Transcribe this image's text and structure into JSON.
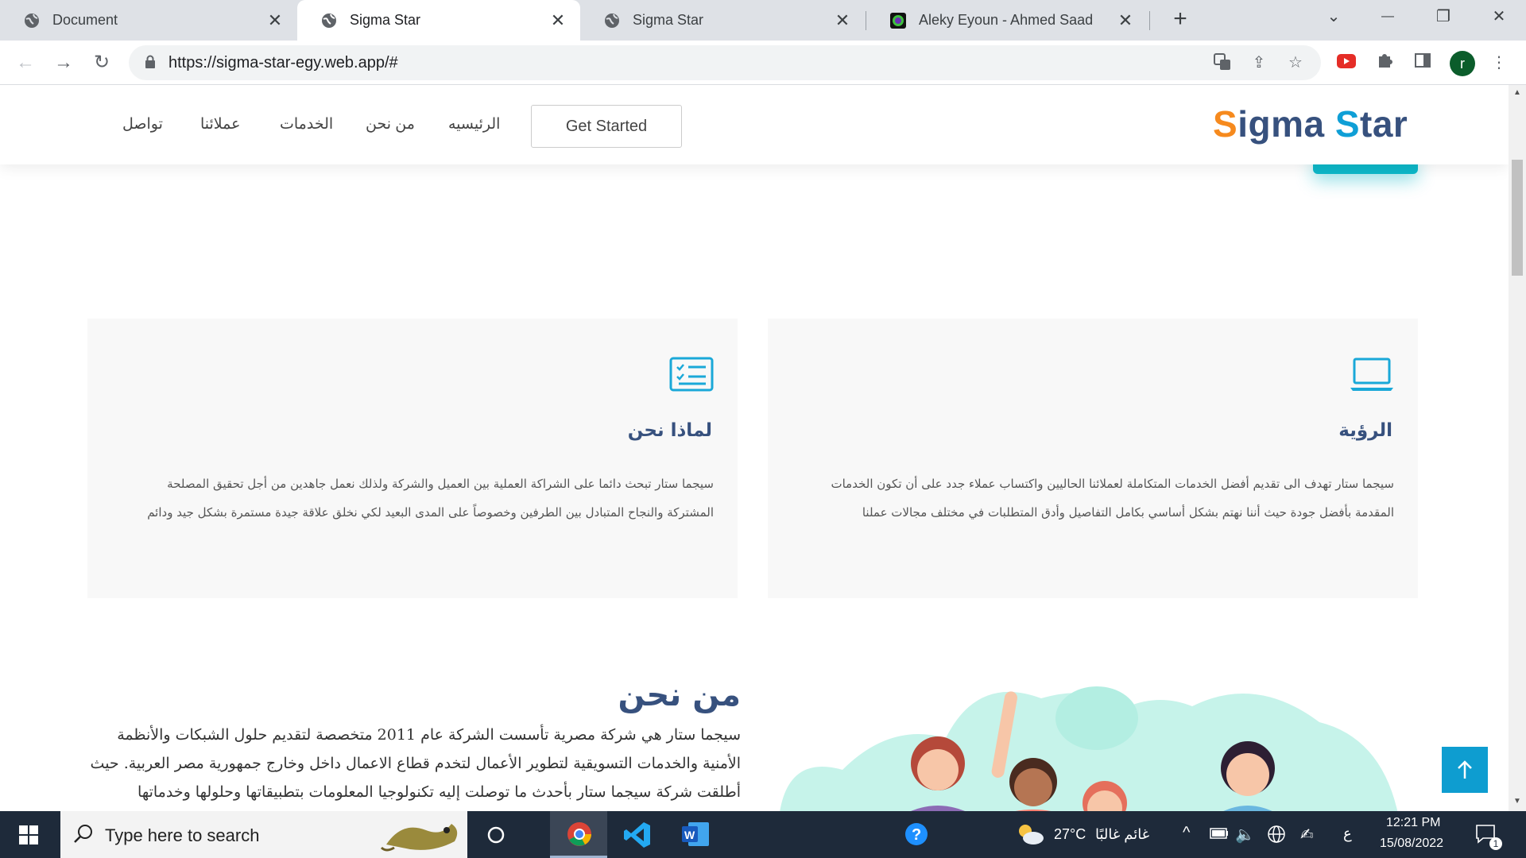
{
  "browser": {
    "tabs": [
      {
        "title": "Document",
        "active": false
      },
      {
        "title": "Sigma Star",
        "active": true
      },
      {
        "title": "Sigma Star",
        "active": false
      },
      {
        "title": "Aleky Eyoun - Ahmed Saad",
        "active": false
      }
    ],
    "new_tab": "+",
    "window_controls": {
      "dropdown": "⌄",
      "minimize": "—",
      "restore": "❐",
      "close": "✕"
    },
    "url": "https://sigma-star-egy.web.app/#"
  },
  "site": {
    "logo": {
      "s1": "S",
      "part1": "igma ",
      "s2": "S",
      "part2": "tar"
    },
    "get_started": "Get Started",
    "menu": [
      "الرئيسيه",
      "من نحن",
      "الخدمات",
      "عملائنا",
      "تواصل"
    ]
  },
  "cards": [
    {
      "title": "الرؤية",
      "icon": "laptop-icon",
      "text": "سيجما ستار تهدف الى تقديم أفضل الخدمات المتكاملة لعملائنا الحاليين واكتساب عملاء جدد على أن تكون الخدمات المقدمة بأفضل جودة حيث أننا نهتم بشكل أساسي بكامل التفاصيل وأدق المتطلبات في مختلف مجالات عملنا"
    },
    {
      "title": "لماذا نحن",
      "icon": "checklist-icon",
      "text": "سيجما ستار تبحث دائما على الشراكة العملية بين العميل والشركة ولذلك نعمل جاهدين من أجل تحقيق المصلحة المشتركة والنجاح المتبادل بين الطرفين وخصوصاً على المدى البعيد لكي نخلق علاقة جيدة مستمرة بشكل جيد ودائم"
    }
  ],
  "about": {
    "title": "من نحن",
    "text": "سيجما ستار هي شركة مصرية تأسست الشركة عام 2011 متخصصة لتقديم حلول الشبكات والأنظمة الأمنية والخدمات التسويقية لتطوير الأعمال لتخدم قطاع الاعمال داخل وخارج جمهورية مصر العربية. حيث أطلقت شركة سيجما ستار بأحدث ما توصلت إليه تكنولوجيا المعلومات بتطبيقاتها وحلولها وخدماتها المتنوعة؛ حيث"
  },
  "back_to_top": "↑",
  "taskbar": {
    "search_placeholder": "Type here to search",
    "weather_temp": "27°C",
    "weather_text": "غائم غالبًا",
    "lang": "ع",
    "time": "12:21 PM",
    "date": "15/08/2022",
    "notifications": "1"
  },
  "colors": {
    "logo_navy": "#37517e",
    "logo_orange": "#f68a1e",
    "logo_blue": "#0f9fd6",
    "accent_teal": "#0db7c8",
    "back_to_top": "#0e9dd0"
  }
}
